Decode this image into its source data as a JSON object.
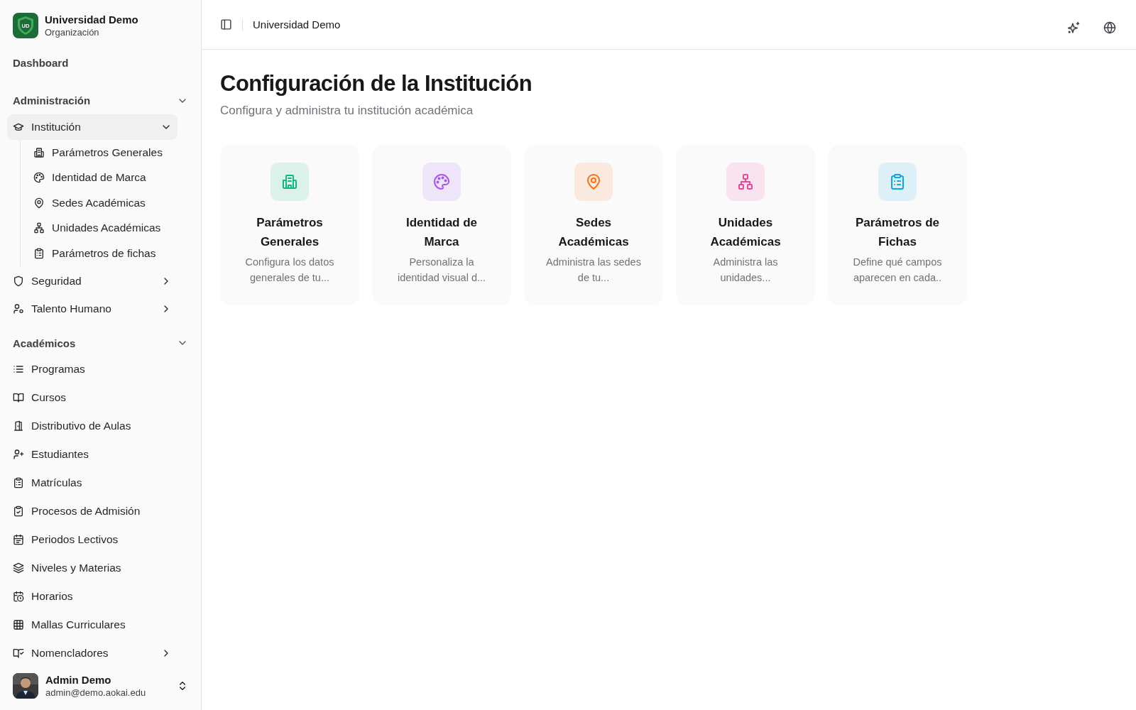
{
  "brand": {
    "name": "Universidad Demo",
    "subtitle": "Organización",
    "logo": "UD"
  },
  "dashboard": {
    "label": "Dashboard",
    "selected": false
  },
  "sidebar_groups": [
    {
      "title": "Administración",
      "expanded": true,
      "items": [
        {
          "label": "Institución",
          "selected": true,
          "expanded": true,
          "children": [
            {
              "label": "Parámetros Generales",
              "selected": false
            },
            {
              "label": "Identidad de Marca",
              "selected": false
            },
            {
              "label": "Sedes Académicas",
              "selected": false
            },
            {
              "label": "Unidades Académicas",
              "selected": false
            },
            {
              "label": "Parámetros de fichas",
              "selected": false
            }
          ]
        },
        {
          "label": "Seguridad",
          "selected": false,
          "expanded": false
        },
        {
          "label": "Talento Humano",
          "selected": false,
          "expanded": false
        }
      ]
    },
    {
      "title": "Académicos",
      "expanded": true,
      "items": [
        {
          "label": "Programas",
          "selected": false
        },
        {
          "label": "Cursos",
          "selected": false
        },
        {
          "label": "Distributivo de Aulas",
          "selected": false
        },
        {
          "label": "Estudiantes",
          "selected": false
        },
        {
          "label": "Matrículas",
          "selected": false
        },
        {
          "label": "Procesos de Admisión",
          "selected": false
        },
        {
          "label": "Periodos Lectivos",
          "selected": false
        },
        {
          "label": "Niveles y Materias",
          "selected": false
        },
        {
          "label": "Horarios",
          "selected": false
        },
        {
          "label": "Mallas Curriculares",
          "selected": false
        },
        {
          "label": "Nomencladores",
          "selected": false,
          "expanded": false
        }
      ]
    }
  ],
  "user": {
    "name": "Admin Demo",
    "email": "admin@demo.aokai.edu"
  },
  "header": {
    "breadcrumb": "Universidad Demo"
  },
  "page": {
    "title": "Configuración de la Institución",
    "subtitle": "Configura y administra tu institución académica"
  },
  "cards": [
    {
      "title": "Parámetros Generales",
      "description": "Configura los datos generales de tu...",
      "color": "#10b981"
    },
    {
      "title": "Identidad de Marca",
      "description": "Personaliza la identidad visual d...",
      "color": "#a855f7"
    },
    {
      "title": "Sedes Académicas",
      "description": "Administra las sedes de tu...",
      "color": "#f97316"
    },
    {
      "title": "Unidades Académicas",
      "description": "Administra las unidades...",
      "color": "#ec4899"
    },
    {
      "title": "Parámetros de Fichas",
      "description": "Define qué campos aparecen en cada..",
      "color": "#0ea5e9"
    }
  ]
}
